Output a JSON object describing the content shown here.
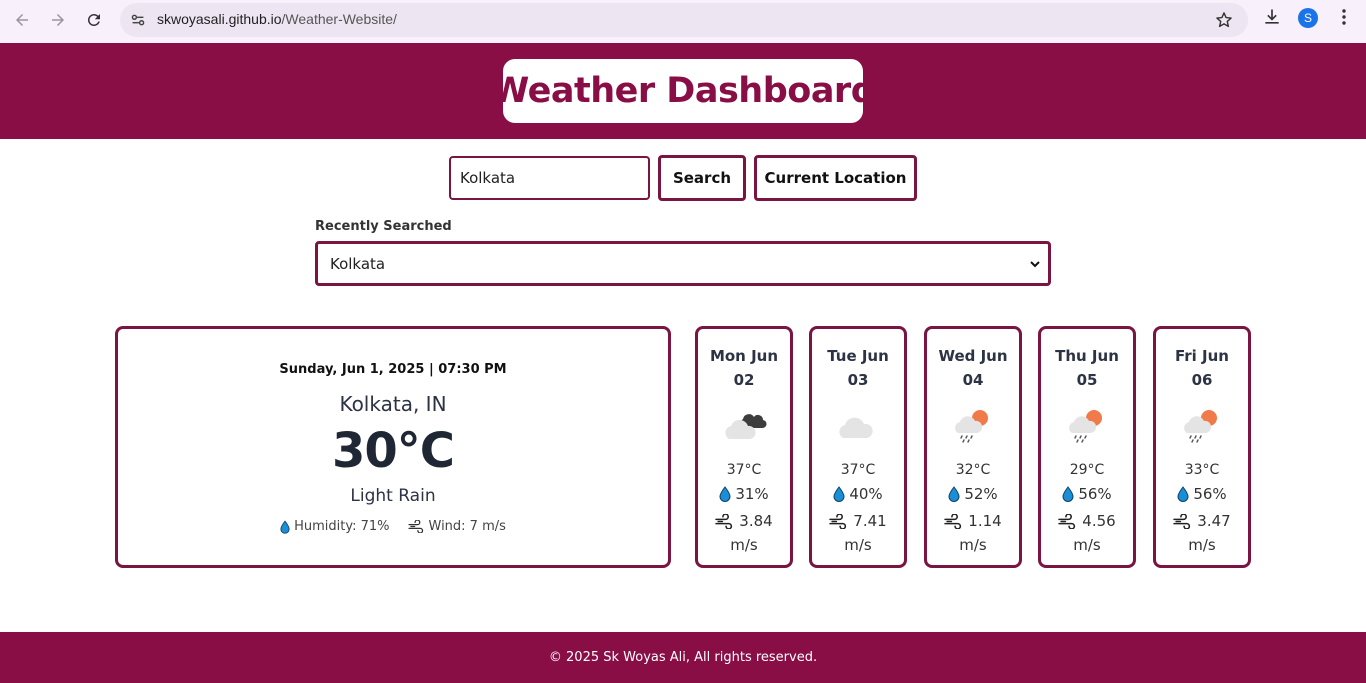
{
  "browser": {
    "url_host": "skwoyasali.github.io",
    "url_path": "/Weather-Website/",
    "profile_initial": "S",
    "icons": [
      "back-arrow-icon",
      "forward-arrow-icon",
      "reload-icon",
      "site-settings-icon",
      "bookmark-star-icon",
      "download-icon",
      "more-vert-icon"
    ]
  },
  "header": {
    "title": "Weather Dashboard"
  },
  "search": {
    "value": "Kolkata",
    "search_label": "Search",
    "location_label": "Current Location"
  },
  "recent": {
    "label": "Recently Searched",
    "selected": "Kolkata"
  },
  "current": {
    "date": "Sunday, Jun 1, 2025 | 07:30 PM",
    "city": "Kolkata, IN",
    "temp": "30°C",
    "condition": "Light Rain",
    "humidity": "Humidity: 71%",
    "wind": "Wind: 7 m/s"
  },
  "forecast": [
    {
      "day": "Mon Jun",
      "date": "02",
      "icon": "broken-clouds-icon",
      "temp": "37°C",
      "humidity": "31%",
      "wind": "3.84",
      "wind_unit": "m/s"
    },
    {
      "day": "Tue Jun",
      "date": "03",
      "icon": "cloud-icon",
      "temp": "37°C",
      "humidity": "40%",
      "wind": "7.41",
      "wind_unit": "m/s"
    },
    {
      "day": "Wed Jun",
      "date": "04",
      "icon": "sun-rain-icon",
      "temp": "32°C",
      "humidity": "52%",
      "wind": "1.14",
      "wind_unit": "m/s"
    },
    {
      "day": "Thu Jun",
      "date": "05",
      "icon": "sun-rain-icon",
      "temp": "29°C",
      "humidity": "56%",
      "wind": "4.56",
      "wind_unit": "m/s"
    },
    {
      "day": "Fri Jun",
      "date": "06",
      "icon": "sun-rain-icon",
      "temp": "33°C",
      "humidity": "56%",
      "wind": "3.47",
      "wind_unit": "m/s"
    }
  ],
  "footer": {
    "text": "© 2025 Sk Woyas Ali, All rights reserved."
  },
  "colors": {
    "brand": "#880e45",
    "border": "#7a1542",
    "droplet": "#1a8fd6"
  }
}
